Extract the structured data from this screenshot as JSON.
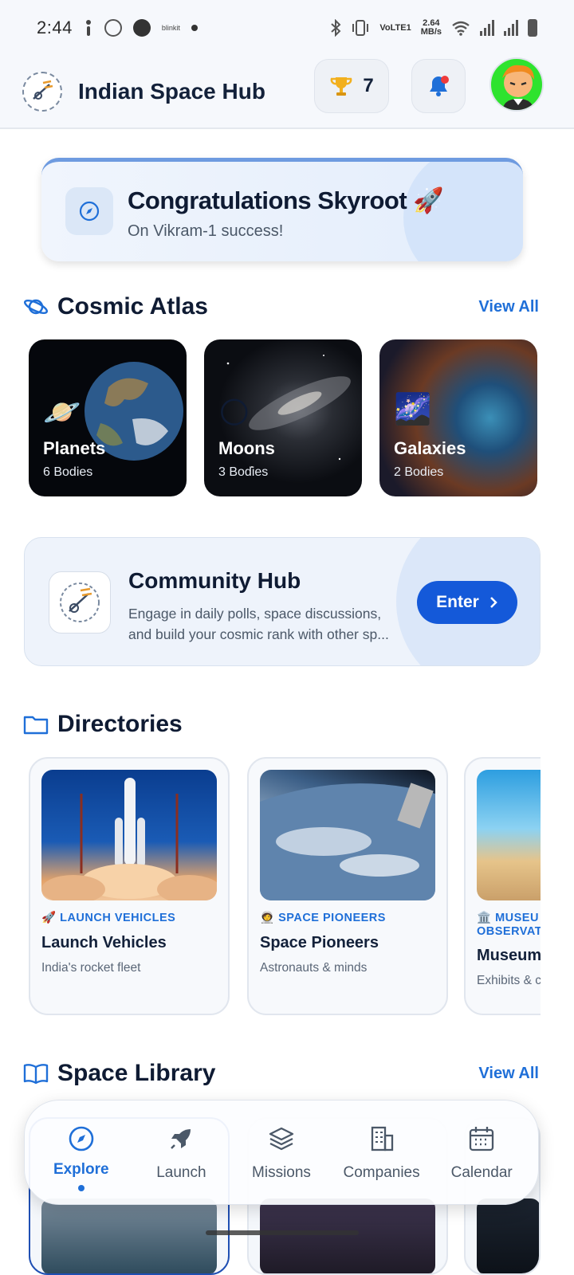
{
  "status_bar": {
    "time": "2:44",
    "app_label": "blinkit",
    "net_speed": "2.64",
    "net_unit": "MB/s",
    "volte": "VoLTE1"
  },
  "header": {
    "title": "Indian Space Hub",
    "trophy_count": "7"
  },
  "banner": {
    "title": "Congratulations Skyroot",
    "emoji": "🚀",
    "subtitle": "On Vikram-1 success!"
  },
  "cosmic_atlas": {
    "title": "Cosmic Atlas",
    "view_all": "View All",
    "cards": [
      {
        "name": "Planets",
        "count": "6 Bodies",
        "emoji": "🪐"
      },
      {
        "name": "Moons",
        "count": "3 Bodies",
        "emoji": "🌕"
      },
      {
        "name": "Galaxies",
        "count": "2 Bodies",
        "emoji": "🌌"
      }
    ]
  },
  "community": {
    "title": "Community Hub",
    "description": "Engage in daily polls, space discussions, and build your cosmic rank with other sp...",
    "button": "Enter"
  },
  "directories": {
    "title": "Directories",
    "cards": [
      {
        "category": "🚀 LAUNCH VEHICLES",
        "title": "Launch Vehicles",
        "desc": "India's rocket fleet"
      },
      {
        "category": "🧑‍🚀 SPACE PIONEERS",
        "title": "Space Pioneers",
        "desc": "Astronauts & minds"
      },
      {
        "category": "🏛️ MUSEU",
        "category2": "OBSERVAT",
        "title": "Museum",
        "desc": "Exhibits & c"
      }
    ]
  },
  "library": {
    "title": "Space Library",
    "view_all": "View All"
  },
  "nav": {
    "items": [
      {
        "label": "Explore",
        "icon": "compass-icon"
      },
      {
        "label": "Launch",
        "icon": "rocket-icon"
      },
      {
        "label": "Missions",
        "icon": "layers-icon"
      },
      {
        "label": "Companies",
        "icon": "building-icon"
      },
      {
        "label": "Calendar",
        "icon": "calendar-icon"
      }
    ]
  },
  "colors": {
    "accent": "#1f6fd8",
    "button": "#1459d9",
    "title": "#0f1b33"
  }
}
